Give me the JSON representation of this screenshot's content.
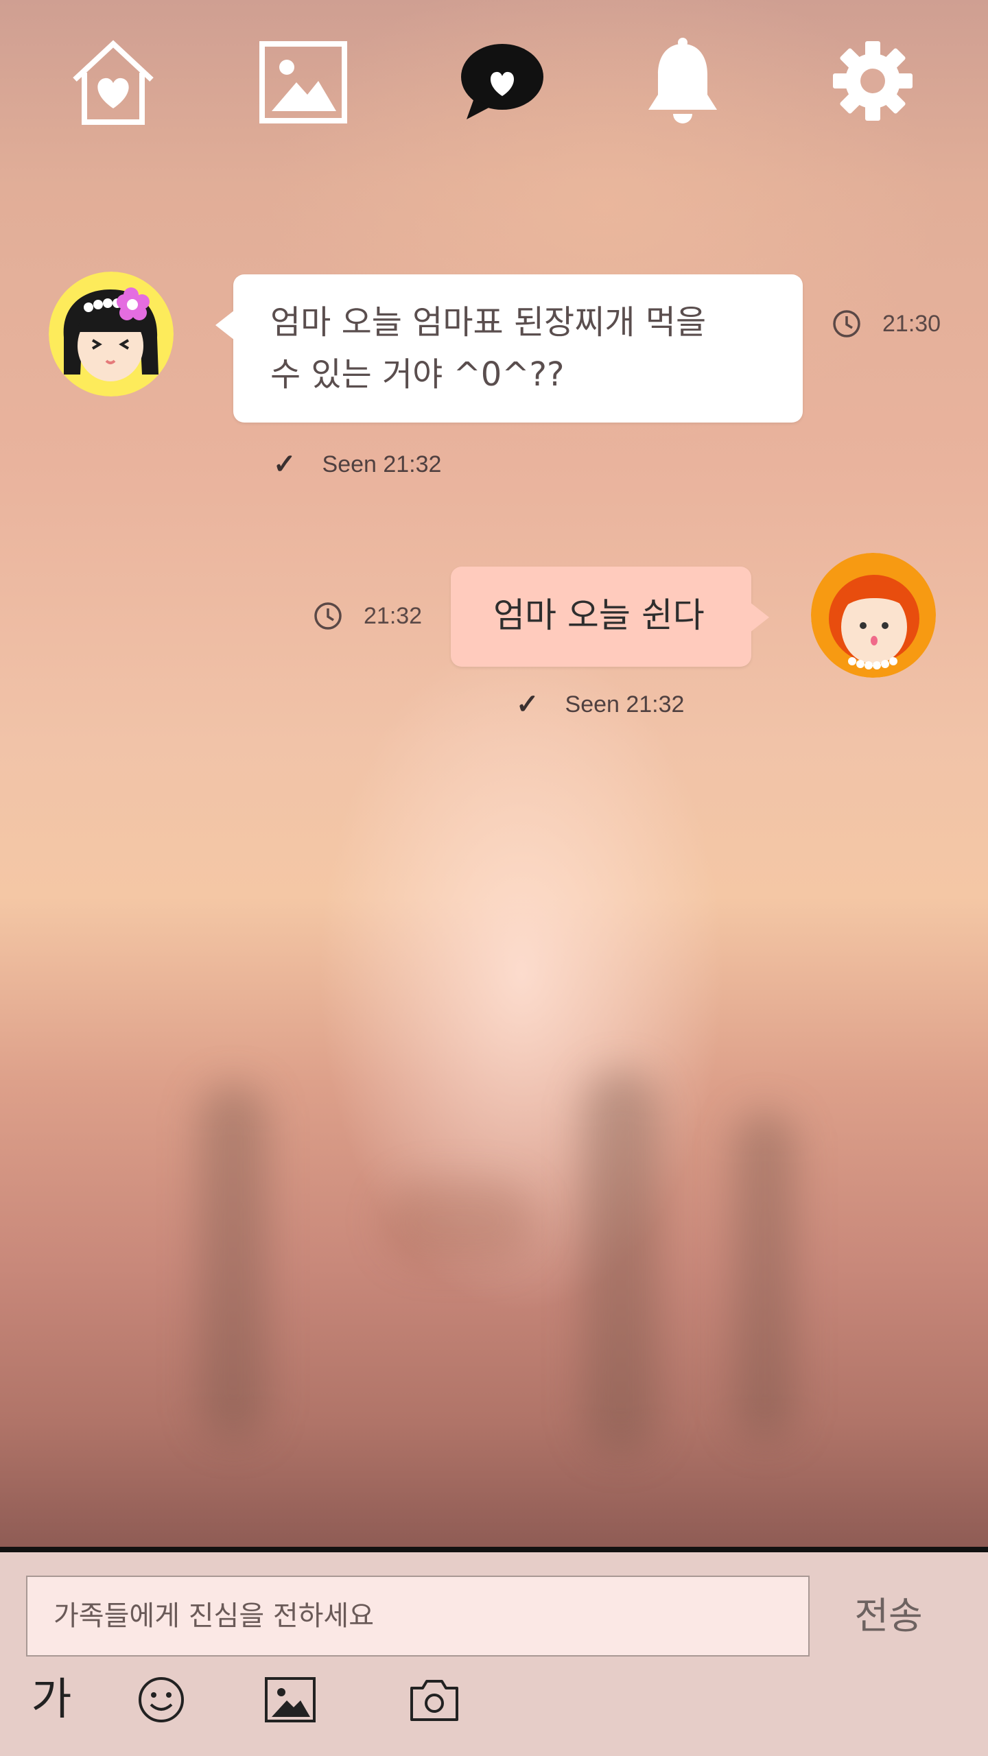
{
  "nav": {
    "items": [
      {
        "name": "home",
        "icon": "house-heart-icon"
      },
      {
        "name": "gallery",
        "icon": "image-icon"
      },
      {
        "name": "chat",
        "icon": "heart-speech-bubble-icon",
        "active": true
      },
      {
        "name": "notifications",
        "icon": "bell-icon"
      },
      {
        "name": "settings",
        "icon": "gear-icon"
      }
    ]
  },
  "messages": [
    {
      "direction": "incoming",
      "avatar": "girl-with-flower-avatar",
      "text_line1": "엄마 오늘 엄마표 된장찌개 먹을",
      "text_line2": "수 있는 거야 ^0^??",
      "time": "21:30",
      "seen": "Seen 21:32"
    },
    {
      "direction": "outgoing",
      "avatar": "red-haired-woman-avatar",
      "text": "엄마 오늘 쉰다",
      "time": "21:32",
      "seen": "Seen 21:32"
    }
  ],
  "composer": {
    "placeholder": "가족들에게 진심을 전하세요",
    "send_label": "전송",
    "tools": {
      "text_label": "가"
    }
  },
  "colors": {
    "incoming_bubble": "#ffffff",
    "outgoing_bubble": "#ffcbbd",
    "composer_bg": "#e6cdc8",
    "input_bg": "#fbe8e5"
  }
}
